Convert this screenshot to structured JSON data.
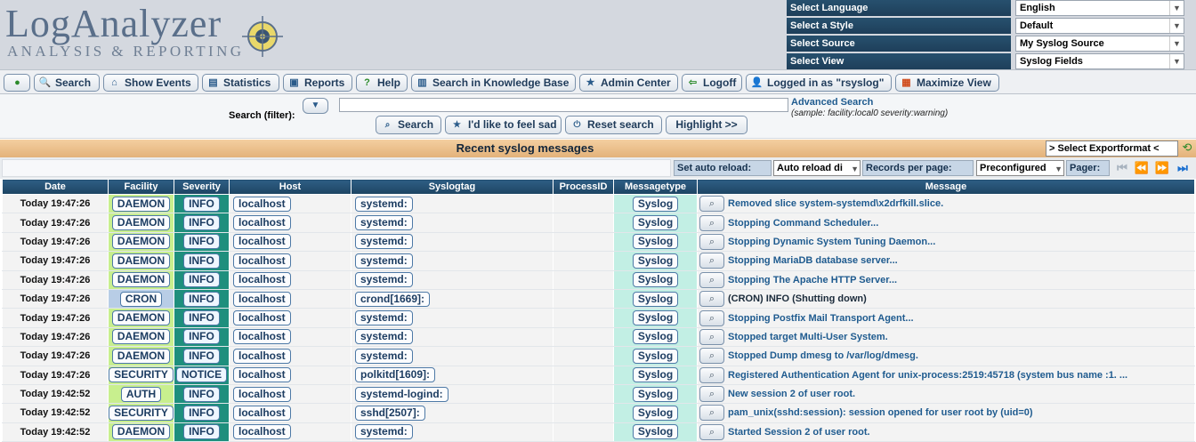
{
  "app": {
    "logo_title": "LogAnalyzer",
    "logo_subtitle": "ANALYSIS & REPORTING"
  },
  "selectors": [
    {
      "label": "Select Language",
      "value": "English"
    },
    {
      "label": "Select a Style",
      "value": "Default"
    },
    {
      "label": "Select Source",
      "value": "My Syslog Source"
    },
    {
      "label": "Select View",
      "value": "Syslog Fields"
    }
  ],
  "nav": {
    "search": "Search",
    "show_events": "Show Events",
    "statistics": "Statistics",
    "reports": "Reports",
    "help": "Help",
    "knowledge_base": "Search in Knowledge Base",
    "admin_center": "Admin Center",
    "logoff": "Logoff",
    "logged_in": "Logged in as \"rsyslog\"",
    "maximize": "Maximize View"
  },
  "search": {
    "label": "Search (filter):",
    "input_value": "",
    "advanced_link": "Advanced Search",
    "sample": "(sample: facility:local0 severity:warning)",
    "search_button": "Search",
    "feel_sad_button": "I'd like to feel sad",
    "reset_button": "Reset search",
    "highlight_button": "Highlight >>"
  },
  "main": {
    "title": "Recent syslog messages",
    "export_select": "> Select Exportformat <"
  },
  "toolbar": {
    "auto_reload_label": "Set auto reload:",
    "auto_reload_value": "Auto reload di",
    "records_label": "Records per page:",
    "records_value": "Preconfigured",
    "pager_label": "Pager:"
  },
  "columns": [
    "Date",
    "Facility",
    "Severity",
    "Host",
    "Syslogtag",
    "ProcessID",
    "Messagetype",
    "Message"
  ],
  "rows": [
    {
      "date": "Today 19:47:26",
      "facility": "DAEMON",
      "severity": "INFO",
      "host": "localhost",
      "tag": "systemd:",
      "pid": "",
      "mtype": "Syslog",
      "message": "Removed slice system-systemd\\x2drfkill.slice."
    },
    {
      "date": "Today 19:47:26",
      "facility": "DAEMON",
      "severity": "INFO",
      "host": "localhost",
      "tag": "systemd:",
      "pid": "",
      "mtype": "Syslog",
      "message": "Stopping Command Scheduler..."
    },
    {
      "date": "Today 19:47:26",
      "facility": "DAEMON",
      "severity": "INFO",
      "host": "localhost",
      "tag": "systemd:",
      "pid": "",
      "mtype": "Syslog",
      "message": "Stopping Dynamic System Tuning Daemon..."
    },
    {
      "date": "Today 19:47:26",
      "facility": "DAEMON",
      "severity": "INFO",
      "host": "localhost",
      "tag": "systemd:",
      "pid": "",
      "mtype": "Syslog",
      "message": "Stopping MariaDB database server..."
    },
    {
      "date": "Today 19:47:26",
      "facility": "DAEMON",
      "severity": "INFO",
      "host": "localhost",
      "tag": "systemd:",
      "pid": "",
      "mtype": "Syslog",
      "message": "Stopping The Apache HTTP Server..."
    },
    {
      "date": "Today 19:47:26",
      "facility": "CRON",
      "severity": "INFO",
      "host": "localhost",
      "tag": "crond[1669]:",
      "pid": "",
      "mtype": "Syslog",
      "message": "(CRON) INFO (Shutting down)"
    },
    {
      "date": "Today 19:47:26",
      "facility": "DAEMON",
      "severity": "INFO",
      "host": "localhost",
      "tag": "systemd:",
      "pid": "",
      "mtype": "Syslog",
      "message": "Stopping Postfix Mail Transport Agent..."
    },
    {
      "date": "Today 19:47:26",
      "facility": "DAEMON",
      "severity": "INFO",
      "host": "localhost",
      "tag": "systemd:",
      "pid": "",
      "mtype": "Syslog",
      "message": "Stopped target Multi-User System."
    },
    {
      "date": "Today 19:47:26",
      "facility": "DAEMON",
      "severity": "INFO",
      "host": "localhost",
      "tag": "systemd:",
      "pid": "",
      "mtype": "Syslog",
      "message": "Stopped Dump dmesg to /var/log/dmesg."
    },
    {
      "date": "Today 19:47:26",
      "facility": "SECURITY",
      "severity": "NOTICE",
      "host": "localhost",
      "tag": "polkitd[1609]:",
      "pid": "",
      "mtype": "Syslog",
      "message": "Registered Authentication Agent for unix-process:2519:45718 (system bus name :1. ..."
    },
    {
      "date": "Today 19:42:52",
      "facility": "AUTH",
      "severity": "INFO",
      "host": "localhost",
      "tag": "systemd-logind:",
      "pid": "",
      "mtype": "Syslog",
      "message": "New session 2 of user root."
    },
    {
      "date": "Today 19:42:52",
      "facility": "SECURITY",
      "severity": "INFO",
      "host": "localhost",
      "tag": "sshd[2507]:",
      "pid": "",
      "mtype": "Syslog",
      "message": "pam_unix(sshd:session): session opened for user root by (uid=0)"
    },
    {
      "date": "Today 19:42:52",
      "facility": "DAEMON",
      "severity": "INFO",
      "host": "localhost",
      "tag": "systemd:",
      "pid": "",
      "mtype": "Syslog",
      "message": "Started Session 2 of user root."
    }
  ]
}
